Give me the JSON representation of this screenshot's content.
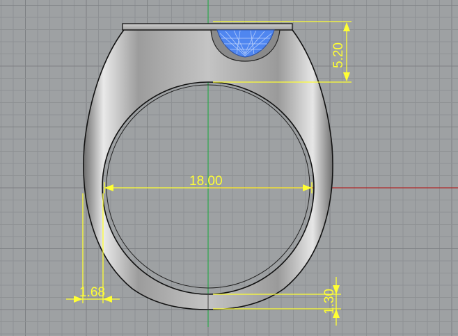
{
  "viewport": {
    "name": "rhino-front-viewport",
    "colors": {
      "background": "#9ea1a3",
      "grid_minor": "#8e9194",
      "grid_major": "#7d8083",
      "x_axis": "#b02a2a",
      "y_axis": "#2aa84a",
      "dimension": "#ffff33",
      "gem": "#4f86f0"
    }
  },
  "dimensions": {
    "inner_diameter": "18.00",
    "top_height": "5.20",
    "side_thickness": "1.68",
    "bottom_thickness": "1.30"
  }
}
